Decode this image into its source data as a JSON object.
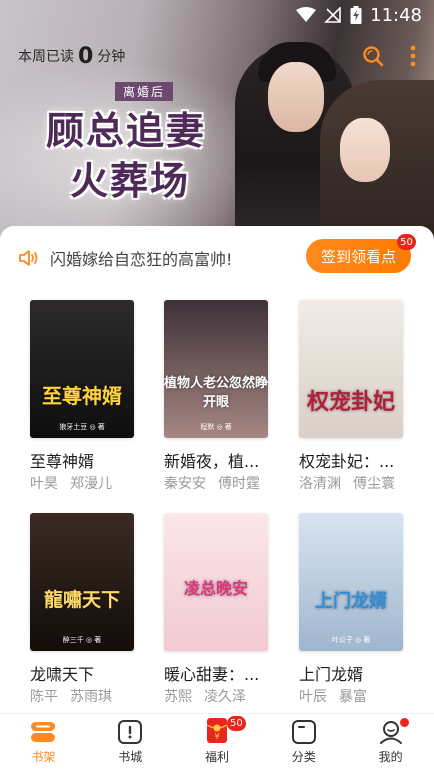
{
  "status_bar": {
    "time": "11:48"
  },
  "read_bar": {
    "prefix": "本周已读",
    "minutes": "0",
    "suffix": "分钟"
  },
  "banner": {
    "subtitle": "离婚后",
    "title_line1": "顾总追妻",
    "title_line2": "火葬场"
  },
  "notice": {
    "message": "闪婚嫁给自恋狂的高富帅!",
    "checkin_label": "签到领看点",
    "checkin_badge": "50"
  },
  "books": [
    {
      "title": "至尊神婿",
      "tags": [
        "叶昊",
        "郑漫儿"
      ],
      "cover_title": "至尊神婿",
      "cover_author": "狼牙土豆 ◎ 著",
      "cover_colors": [
        "#2c2a2b",
        "#0f0e0f"
      ],
      "cover_title_color": "#ffd23a"
    },
    {
      "title": "新婚夜，植...",
      "tags": [
        "秦安安",
        "傅时霆"
      ],
      "cover_title": "植物人老公忽然睁开眼",
      "cover_author": "程默 ◎ 著",
      "cover_colors": [
        "#3d3138",
        "#a68782"
      ],
      "cover_title_color": "#ffffff"
    },
    {
      "title": "权宠卦妃：...",
      "tags": [
        "洛清渊",
        "傅尘寰"
      ],
      "cover_title": "权宠卦妃",
      "cover_author": "",
      "cover_colors": [
        "#f1ece6",
        "#d9cfc6"
      ],
      "cover_title_color": "#b0203a"
    },
    {
      "title": "龙啸天下",
      "tags": [
        "陈平",
        "苏雨琪"
      ],
      "cover_title": "龍嘯天下",
      "cover_author": "醉三千 ◎ 著",
      "cover_colors": [
        "#3a2b22",
        "#130d0a"
      ],
      "cover_title_color": "#ffd966"
    },
    {
      "title": "暖心甜妻：...",
      "tags": [
        "苏熙",
        "凌久泽"
      ],
      "cover_title": "凌总晚安",
      "cover_author": "",
      "cover_colors": [
        "#fbe6ea",
        "#f1c9d2"
      ],
      "cover_title_color": "#e0357a"
    },
    {
      "title": "上门龙婿",
      "tags": [
        "叶辰",
        "暴富"
      ],
      "cover_title": "上门龙婿",
      "cover_author": "叶公子 ◎ 著",
      "cover_colors": [
        "#d9e4f0",
        "#9fb6cf"
      ],
      "cover_title_color": "#2f8fd8"
    }
  ],
  "tabbar": {
    "items": [
      {
        "label": "书架",
        "icon": "bookshelf-icon",
        "active": true
      },
      {
        "label": "书城",
        "icon": "bookstore-icon",
        "active": false
      },
      {
        "label": "福利",
        "icon": "red-packet-icon",
        "active": false,
        "badge": "50"
      },
      {
        "label": "分类",
        "icon": "category-icon",
        "active": false
      },
      {
        "label": "我的",
        "icon": "profile-icon",
        "active": false,
        "dot": true
      }
    ]
  },
  "colors": {
    "accent": "#ff8a1f",
    "badge": "#e8261d"
  }
}
